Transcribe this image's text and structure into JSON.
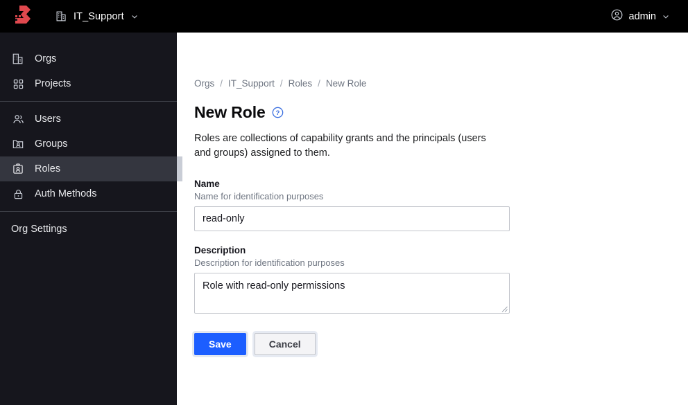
{
  "header": {
    "logo_icon": "boundary-logo",
    "logo_color": "#e0484e",
    "org_icon": "building-icon",
    "org_name": "IT_Support",
    "org_chevron_icon": "chevron-down-icon",
    "user_icon": "user-circle-icon",
    "user_name": "admin",
    "user_chevron_icon": "chevron-down-icon",
    "background": "#000000"
  },
  "sidebar": {
    "background": "#16161d",
    "active_background": "#34363f",
    "groups": [
      {
        "items": [
          {
            "label": "Orgs",
            "icon": "building-icon",
            "active": false
          },
          {
            "label": "Projects",
            "icon": "grid-icon",
            "active": false
          }
        ]
      },
      {
        "items": [
          {
            "label": "Users",
            "icon": "users-icon",
            "active": false
          },
          {
            "label": "Groups",
            "icon": "folder-user-icon",
            "active": false
          },
          {
            "label": "Roles",
            "icon": "id-card-icon",
            "active": true
          },
          {
            "label": "Auth Methods",
            "icon": "lock-icon",
            "active": false
          }
        ]
      },
      {
        "items": [
          {
            "label": "Org Settings",
            "icon": null,
            "active": false
          }
        ]
      }
    ]
  },
  "main": {
    "breadcrumbs": [
      {
        "label": "Orgs",
        "current": false
      },
      {
        "label": "IT_Support",
        "current": false
      },
      {
        "label": "Roles",
        "current": false
      },
      {
        "label": "New Role",
        "current": true
      }
    ],
    "breadcrumb_separator": "/",
    "page_title": "New Role",
    "help_icon": "question-circle-icon",
    "help_icon_color": "#3b6fe0",
    "page_description": "Roles are collections of capability grants and the principals (users and groups) assigned to them.",
    "fields": {
      "name": {
        "label": "Name",
        "help": "Name for identification purposes",
        "value": "read-only",
        "placeholder": "Name"
      },
      "description": {
        "label": "Description",
        "help": "Description for identification purposes",
        "value": "Role with read-only permissions",
        "placeholder": "Description"
      }
    },
    "actions": {
      "save_label": "Save",
      "save_color": "#1c5eff",
      "cancel_label": "Cancel"
    }
  }
}
